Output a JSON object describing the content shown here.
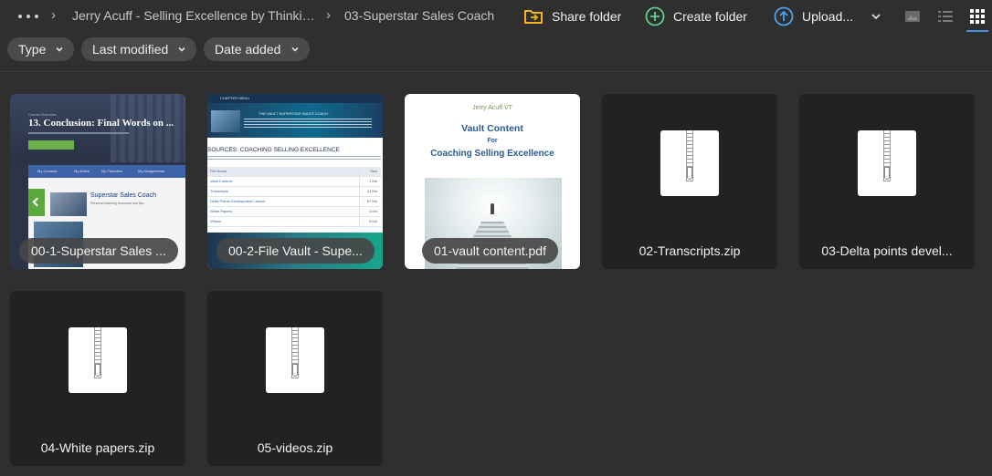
{
  "breadcrumb": {
    "more_label": "•••",
    "items": [
      {
        "label": "Jerry Acuff - Selling Excellence by Thinkin..."
      },
      {
        "label": "03-Superstar Sales Coach"
      }
    ]
  },
  "toolbar": {
    "share_label": "Share folder",
    "create_label": "Create folder",
    "upload_label": "Upload...",
    "accent_colors": {
      "share": "#f2b51c",
      "create": "#5fcf8b",
      "upload": "#4aa3f0",
      "active_view": "#4a90e2"
    }
  },
  "filters": [
    {
      "label": "Type"
    },
    {
      "label": "Last modified"
    },
    {
      "label": "Date added"
    }
  ],
  "files": [
    {
      "name": "00-1-Superstar Sales ...",
      "kind": "thumbnail"
    },
    {
      "name": "00-2-File Vault - Supe...",
      "kind": "thumbnail"
    },
    {
      "name": "01-vault content.pdf",
      "kind": "thumbnail"
    },
    {
      "name": "02-Transcripts.zip",
      "kind": "zip"
    },
    {
      "name": "03-Delta points devel...",
      "kind": "zip"
    },
    {
      "name": "04-White papers.zip",
      "kind": "zip"
    },
    {
      "name": "05-videos.zip",
      "kind": "zip"
    }
  ],
  "thumb1": {
    "kicker": "Course Overview",
    "title": "13. Conclusion: Final Words on ...",
    "nav": [
      "My Courses",
      "My Notes",
      "My Favorites",
      "My Assignments"
    ],
    "coach": "Superstar Sales Coach",
    "coach_sub": "Personal coaching resources and tips"
  },
  "thumb2": {
    "topbar": "CHAPTER MENU",
    "header": "THE VAULT SUPERSTAR SALES COACH",
    "sources": "SOURCES: COACHING SELLING EXCELLENCE",
    "rows": [
      {
        "name": "File Name",
        "size": "Size"
      },
      {
        "name": "Vault Content",
        "size": "1 Mo"
      },
      {
        "name": "Transcripts",
        "size": "41 Mo"
      },
      {
        "name": "Delta Points Development Lesson",
        "size": "67 Mo"
      },
      {
        "name": "White Papers",
        "size": "4 Mo"
      },
      {
        "name": "Videos",
        "size": "5 Mo"
      }
    ]
  },
  "thumb3": {
    "author": "Jerry Acuff VT",
    "line1": "Vault Content",
    "line2": "For",
    "line3": "Coaching Selling Excellence"
  }
}
